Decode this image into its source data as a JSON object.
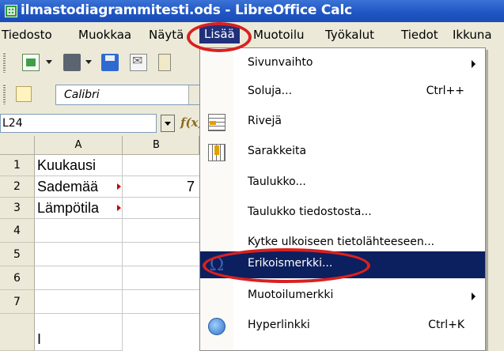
{
  "window": {
    "title": "ilmastodiagrammitesti.ods - LibreOffice Calc"
  },
  "menubar": [
    "Tiedosto",
    "Muokkaa",
    "Näytä",
    "Lisää",
    "Muotoilu",
    "Työkalut",
    "Tiedot",
    "Ikkuna"
  ],
  "font": {
    "name": "Calibri"
  },
  "namebox": {
    "value": "L24"
  },
  "formula": {
    "fx_icon": "function-wizard-icon"
  },
  "sheet": {
    "columns": [
      "A",
      "B"
    ],
    "rows": [
      "1",
      "2",
      "3",
      "4",
      "5",
      "6",
      "7"
    ],
    "cells": {
      "A1": "Kuukausi",
      "A2": "Sademää",
      "B2": "7",
      "A3": "Lämpötila",
      "A8": "I"
    }
  },
  "insert_menu": {
    "items": [
      {
        "label": "Sivunvaihto",
        "shortcut": "",
        "submenu": true,
        "icon": ""
      },
      {
        "label": "Soluja...",
        "shortcut": "Ctrl++",
        "submenu": false,
        "icon": ""
      },
      {
        "label": "Rivejä",
        "shortcut": "",
        "submenu": false,
        "icon": "insert-rows-icon"
      },
      {
        "label": "Sarakkeita",
        "shortcut": "",
        "submenu": false,
        "icon": "insert-columns-icon"
      },
      {
        "label": "Taulukko...",
        "shortcut": "",
        "submenu": false,
        "icon": ""
      },
      {
        "label": "Taulukko tiedostosta...",
        "shortcut": "",
        "submenu": false,
        "icon": ""
      },
      {
        "label": "Kytke ulkoiseen tietolähteeseen...",
        "shortcut": "",
        "submenu": false,
        "icon": ""
      },
      {
        "label": "Erikoismerkki...",
        "shortcut": "",
        "submenu": false,
        "icon": "special-character-icon",
        "highlighted": true
      },
      {
        "label": "Muotoilumerkki",
        "shortcut": "",
        "submenu": true,
        "icon": ""
      },
      {
        "label": "Hyperlinkki",
        "shortcut": "Ctrl+K",
        "submenu": false,
        "icon": "hyperlink-icon"
      }
    ]
  },
  "colors": {
    "highlight": "#0c1f5e",
    "annotation_ring": "#d8211f",
    "titlebar": "#1f56c4"
  }
}
